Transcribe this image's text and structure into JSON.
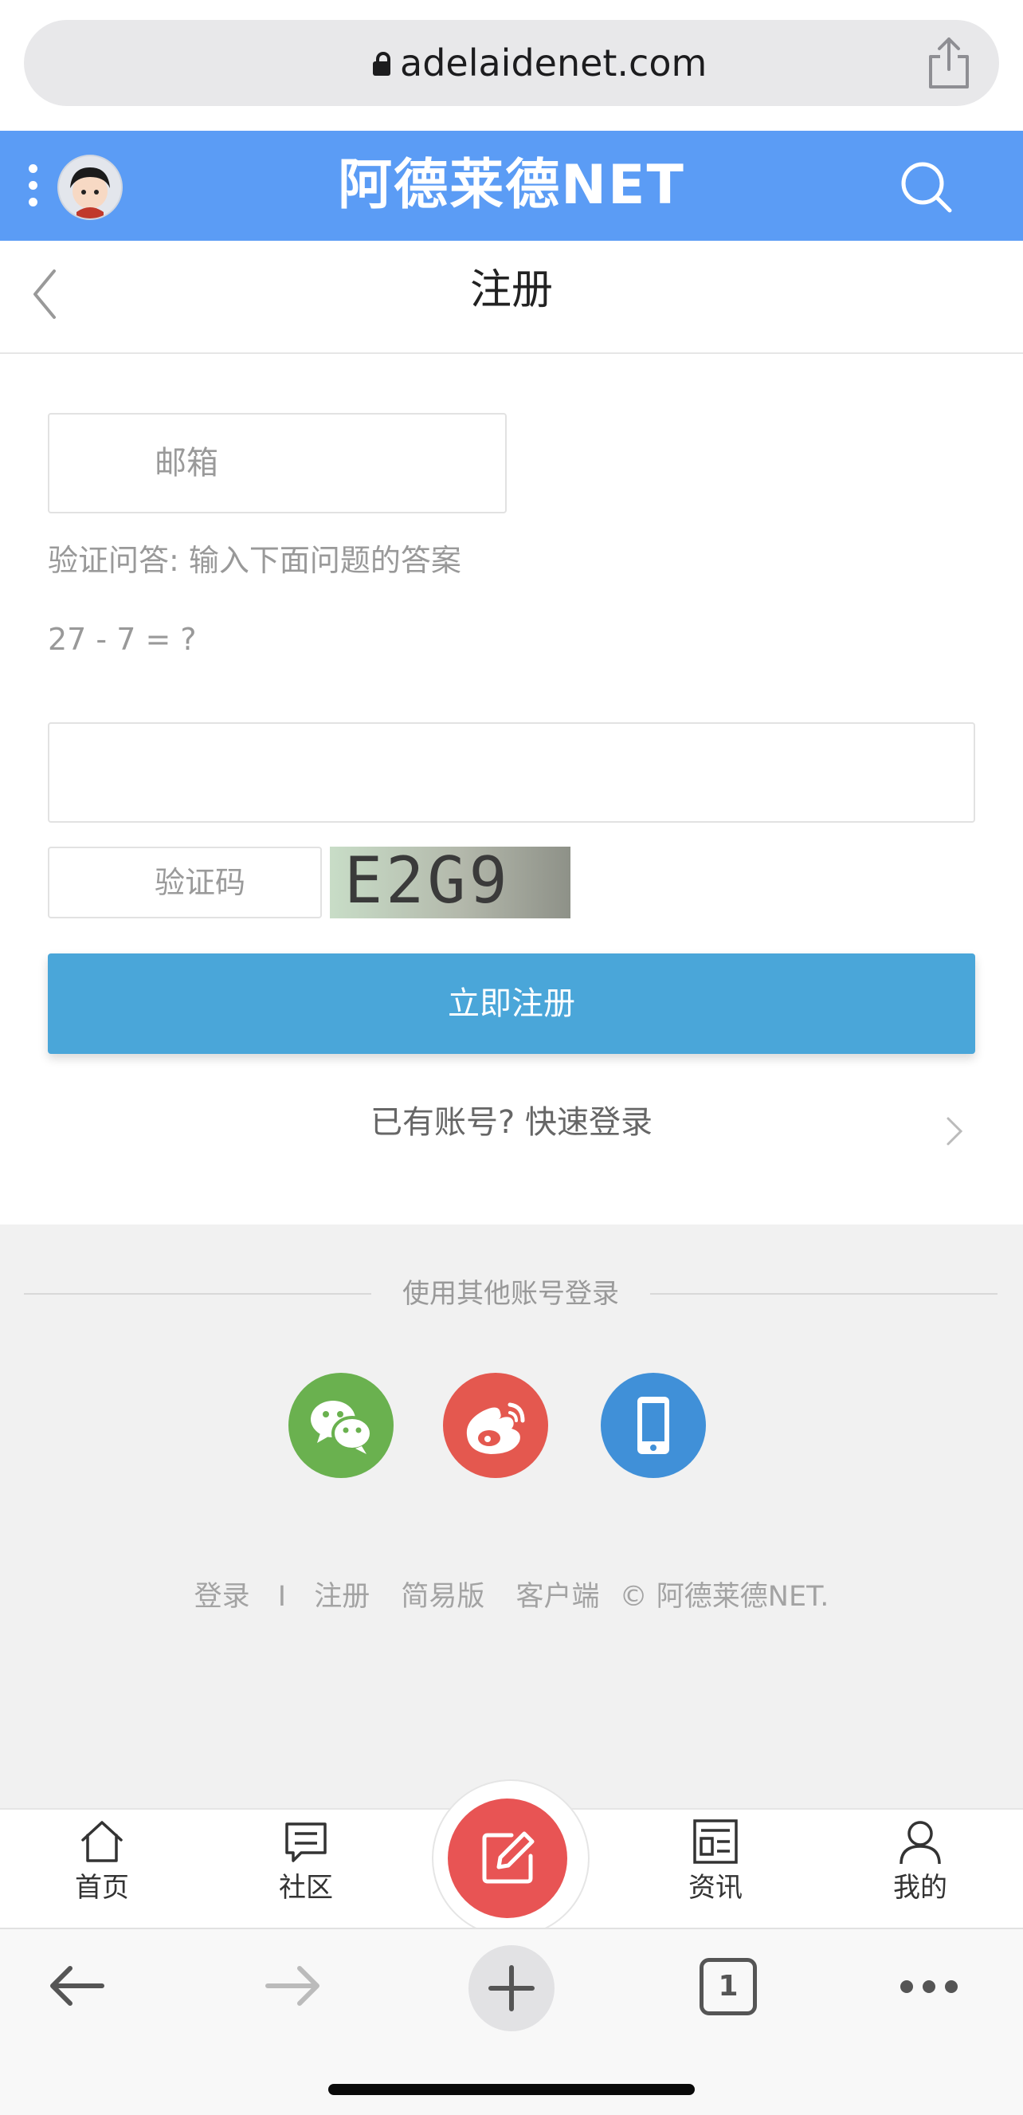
{
  "browser": {
    "url": "adelaidenet.com"
  },
  "site": {
    "brand": "阿德莱德NET"
  },
  "page": {
    "title": "注册"
  },
  "form": {
    "email_placeholder": "邮箱",
    "question_hint": "验证问答: 输入下面问题的答案",
    "question": "27 - 7 = ?",
    "answer_value": "",
    "captcha_placeholder": "验证码",
    "captcha_image_text": "E2G9",
    "submit_label": "立即注册",
    "login_link": "已有账号? 快速登录"
  },
  "social": {
    "label": "使用其他账号登录",
    "icons": [
      "wechat-icon",
      "weibo-icon",
      "phone-icon"
    ],
    "colors": {
      "wechat": "#6ab14f",
      "weibo": "#e4584f",
      "phone": "#4090d8"
    }
  },
  "footer": {
    "links": [
      "登录",
      "注册",
      "简易版",
      "客户端"
    ],
    "separator": "I",
    "copyright": "© 阿德莱德NET."
  },
  "tabbar": {
    "items": [
      {
        "label": "首页",
        "icon": "home-icon"
      },
      {
        "label": "社区",
        "icon": "chat-icon"
      },
      {
        "label": "资讯",
        "icon": "news-icon"
      },
      {
        "label": "我的",
        "icon": "user-icon"
      }
    ],
    "center_icon": "edit-icon"
  },
  "toolbar": {
    "tabs_count": "1"
  },
  "colors": {
    "header": "#5b9cf5",
    "submit": "#4aa6d9",
    "post": "#e85454"
  }
}
